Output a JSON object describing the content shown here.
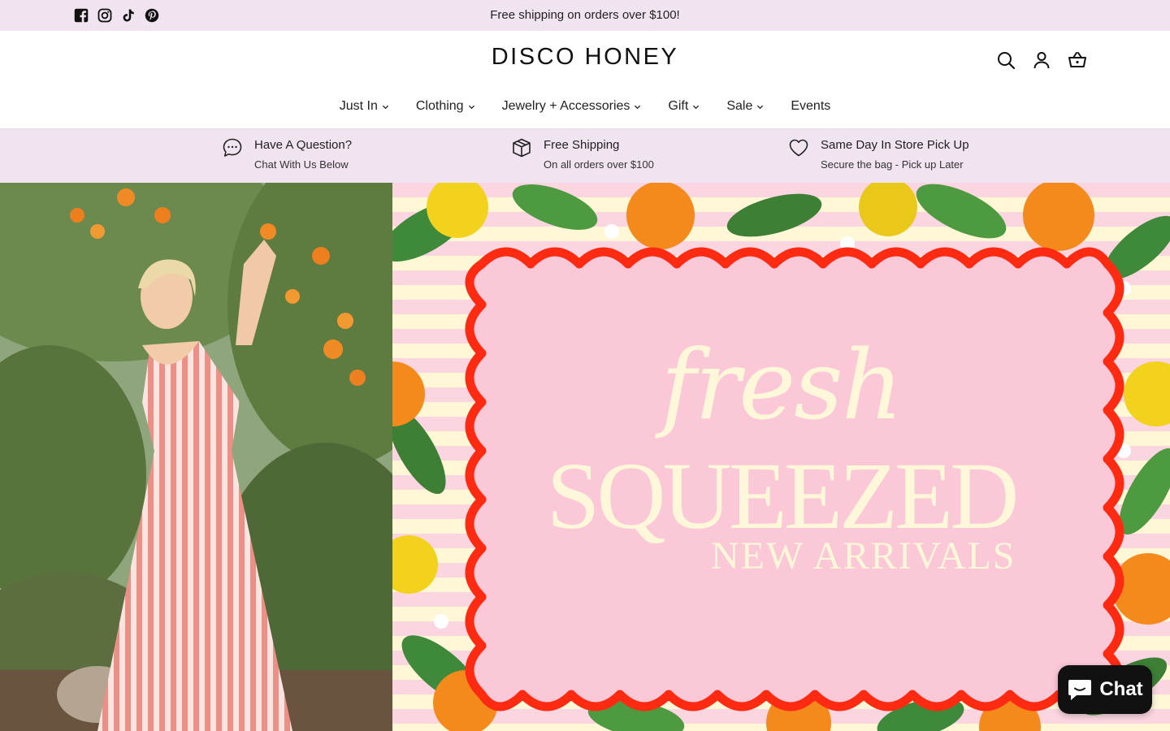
{
  "announcement": {
    "text": "Free shipping on orders over $100!",
    "socials": [
      "facebook-icon",
      "instagram-icon",
      "tiktok-icon",
      "pinterest-icon"
    ]
  },
  "header": {
    "logo": "DISCO HONEY",
    "icons": [
      "search-icon",
      "account-icon",
      "cart-icon"
    ]
  },
  "nav": [
    {
      "label": "Just In",
      "dropdown": true
    },
    {
      "label": "Clothing",
      "dropdown": true
    },
    {
      "label": "Jewelry + Accessories",
      "dropdown": true
    },
    {
      "label": "Gift",
      "dropdown": true
    },
    {
      "label": "Sale",
      "dropdown": true
    },
    {
      "label": "Events",
      "dropdown": false
    }
  ],
  "features": [
    {
      "icon": "chat-bubble-icon",
      "title": "Have A Question?",
      "subtitle": "Chat With Us Below"
    },
    {
      "icon": "box-icon",
      "title": "Free Shipping",
      "subtitle": "On all orders over $100"
    },
    {
      "icon": "heart-icon",
      "title": "Same Day In Store Pick Up",
      "subtitle": "Secure the bag - Pick up Later"
    }
  ],
  "hero": {
    "script_text": "fresh",
    "headline": "SQUEEZED",
    "subheadline": "NEW ARRIVALS"
  },
  "chat": {
    "label": "Chat"
  },
  "colors": {
    "announce_bg": "#f1e4f1",
    "frame_red": "#ff2a12",
    "hero_pink": "#fbc8d8",
    "hero_text": "#fff7d9"
  }
}
